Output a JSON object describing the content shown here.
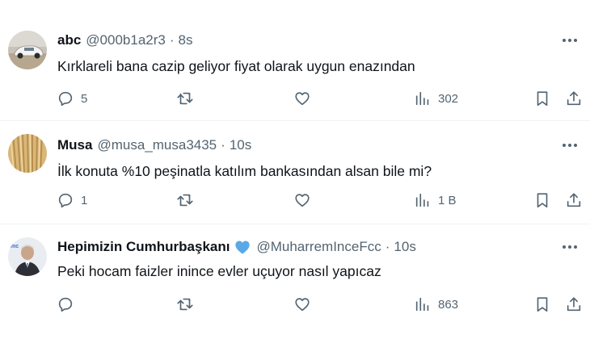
{
  "tweets": [
    {
      "name": "abc",
      "handle": "@000b1a2r3",
      "separator": "·",
      "time": "8s",
      "text": "Kırklareli bana cazip geliyor fiyat olarak uygun enazından",
      "replies": "5",
      "views": "302"
    },
    {
      "name": "Musa",
      "handle": "@musa_musa3435",
      "separator": "·",
      "time": "10s",
      "text": "İlk konuta %10 peşinatla katılım bankasından alsan bile mi?",
      "replies": "1",
      "views": "1 B"
    },
    {
      "name": "Hepimizin Cumhurbaşkanı",
      "handle": "@MuharremInceFcc",
      "separator": "·",
      "time": "10s",
      "text": "Peki hocam faizler inince evler uçuyor nasıl yapıcaz",
      "replies": "",
      "views": "863",
      "avatar_badge": "mc"
    }
  ],
  "icons": {
    "reply": "reply-icon",
    "retweet": "retweet-icon",
    "like": "heart-icon",
    "views": "views-chart-icon",
    "bookmark": "bookmark-icon",
    "share": "share-icon",
    "more": "more-dots-icon",
    "verified": "blue-heart-icon"
  },
  "colors": {
    "text": "#0f1419",
    "secondary": "#536471",
    "divider": "#eff3f4",
    "heart": "#5aa9e6"
  }
}
